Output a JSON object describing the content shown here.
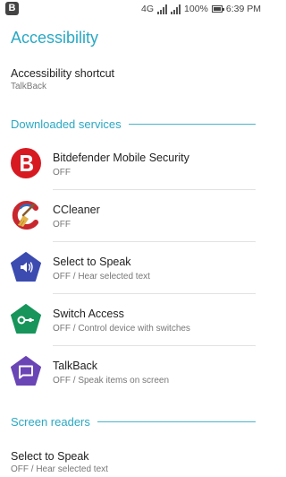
{
  "status_bar": {
    "app_badge": "B",
    "network": "4G",
    "sim1": "1",
    "sim2": "2",
    "battery": "100%",
    "time": "6:39 PM"
  },
  "page": {
    "title": "Accessibility"
  },
  "shortcut": {
    "title": "Accessibility shortcut",
    "subtitle": "TalkBack"
  },
  "sections": {
    "downloaded": "Downloaded services",
    "screen_readers": "Screen readers"
  },
  "services": [
    {
      "title": "Bitdefender Mobile Security",
      "subtitle": "OFF",
      "icon": "bitdefender-icon",
      "color": "#d71a21"
    },
    {
      "title": "CCleaner",
      "subtitle": "OFF",
      "icon": "ccleaner-icon",
      "color": "#c8272e"
    },
    {
      "title": "Select to Speak",
      "subtitle": "OFF / Hear selected text",
      "icon": "select-to-speak-icon",
      "color": "#3b4bb0"
    },
    {
      "title": "Switch Access",
      "subtitle": "OFF / Control device with switches",
      "icon": "switch-access-icon",
      "color": "#17955a"
    },
    {
      "title": "TalkBack",
      "subtitle": "OFF / Speak items on screen",
      "icon": "talkback-icon",
      "color": "#6a45b5"
    }
  ],
  "screen_reader_item": {
    "title": "Select to Speak",
    "subtitle": "OFF / Hear selected text"
  },
  "colors": {
    "accent": "#29a8c4",
    "primary_text": "#222222",
    "secondary_text": "#777777"
  }
}
